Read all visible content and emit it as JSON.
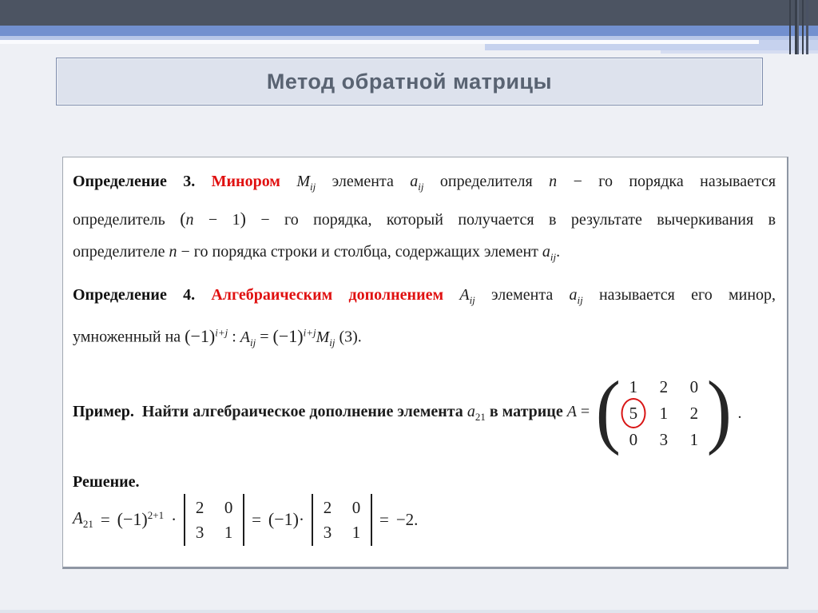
{
  "colors": {
    "accent_red": "#e01010",
    "title_text": "#596372",
    "bar_dark": "#4c5462",
    "bar_blue": "#7290cf",
    "bar_light_blue": "#b6c6e8"
  },
  "title": {
    "text": "Метод обратной матрицы"
  },
  "content": {
    "def3": {
      "label": "Определение 3.",
      "term": "Минором",
      "M": "M",
      "Msub": "ij",
      "w1": "элемента",
      "a1": "a",
      "a1sub": "ij",
      "w2": "определителя",
      "n1": "n",
      "w3": "− го порядка называется",
      "l2w1": "определитель",
      "l2po": "(",
      "l2n": "n",
      "l2m1": " − 1",
      "l2pc": ")",
      "l2w2": "− го порядка, который получается в результате вычеркивания в",
      "l3w1": "определителе",
      "l3n": "n",
      "l3w2": "− го порядка строки и столбца, содержащих элемент",
      "l3a": "a",
      "l3asub": "ij",
      "l3dot": "."
    },
    "def4": {
      "label": "Определение 4.",
      "term": "Алгебраическим дополнением",
      "A1": "A",
      "A1sub": "ij",
      "w1": "элемента",
      "a1": "a",
      "a1sub": "ij",
      "w2": "называется его минор,",
      "l2w1": "умноженный на",
      "pow1base": "(−1)",
      "pow1exp": "i+j",
      "colon": ":",
      "A2": "A",
      "A2sub": "ij",
      "eq": "=",
      "pow2base": "(−1)",
      "pow2exp": "i+j",
      "M2": "M",
      "M2sub": "ij",
      "tag": "(3)."
    },
    "example": {
      "label": "Пример.",
      "w1": "Найти алгебраическое дополнение элемента",
      "a1": "a",
      "a1sub": "21",
      "w2": "в матрице",
      "A": "A",
      "eq": "=",
      "paren_open": "(",
      "paren_close": ")",
      "matrix": [
        [
          "1",
          "2",
          "0"
        ],
        [
          "5",
          "1",
          "2"
        ],
        [
          "0",
          "3",
          "1"
        ]
      ],
      "circled_value": "5",
      "period": "."
    },
    "solution": {
      "label": "Решение.",
      "A": "A",
      "Asub": "21",
      "eq1": "=",
      "pow_base": "(−1)",
      "pow_exp": "2+1",
      "cdot": "·",
      "det1": [
        [
          "2",
          "0"
        ],
        [
          "3",
          "1"
        ]
      ],
      "eq2": "=",
      "neg1": "(−1)",
      "cdot2": "·",
      "det2": [
        [
          "2",
          "0"
        ],
        [
          "3",
          "1"
        ]
      ],
      "eq3": "=",
      "result": "−2."
    }
  }
}
